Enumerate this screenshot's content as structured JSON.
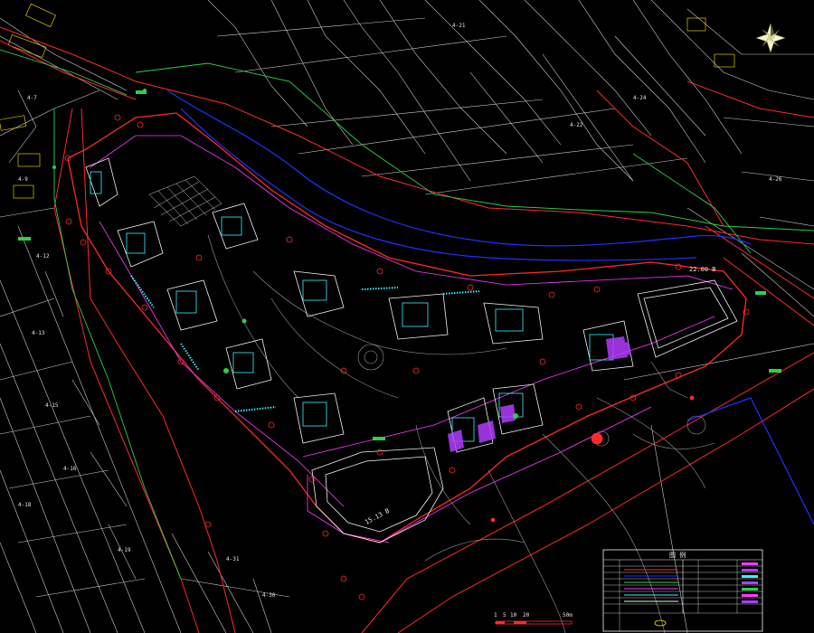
{
  "palette": {
    "background": "#000000",
    "parcel": "#d8d8d8",
    "boundary": "#ff2a2a",
    "road_green": "#2bd14a",
    "river": "#2030ff",
    "road_magenta": "#ff3cff",
    "building_cyan": "#35f3ff",
    "building_white": "#f2f2f2",
    "highlight_purple": "#b23cff",
    "yellow": "#ffe600"
  },
  "map": {
    "north_arrow_icon": "compass-rose-icon",
    "scale_bar_icon": "scale-bar-icon",
    "scale_ticks": [
      "1",
      "5",
      "10",
      "20",
      "50m"
    ],
    "road_width_labels": [
      "15.13 B",
      "22.00 B"
    ],
    "parcel_labels": [
      "4-7",
      "4-9",
      "4-12",
      "4-13",
      "4-15",
      "4-16",
      "4-18",
      "4-19",
      "4-21",
      "4-22",
      "4-24",
      "4-26",
      "4-30",
      "4-31"
    ],
    "legend": {
      "title": "图 例",
      "rows": 9
    }
  }
}
